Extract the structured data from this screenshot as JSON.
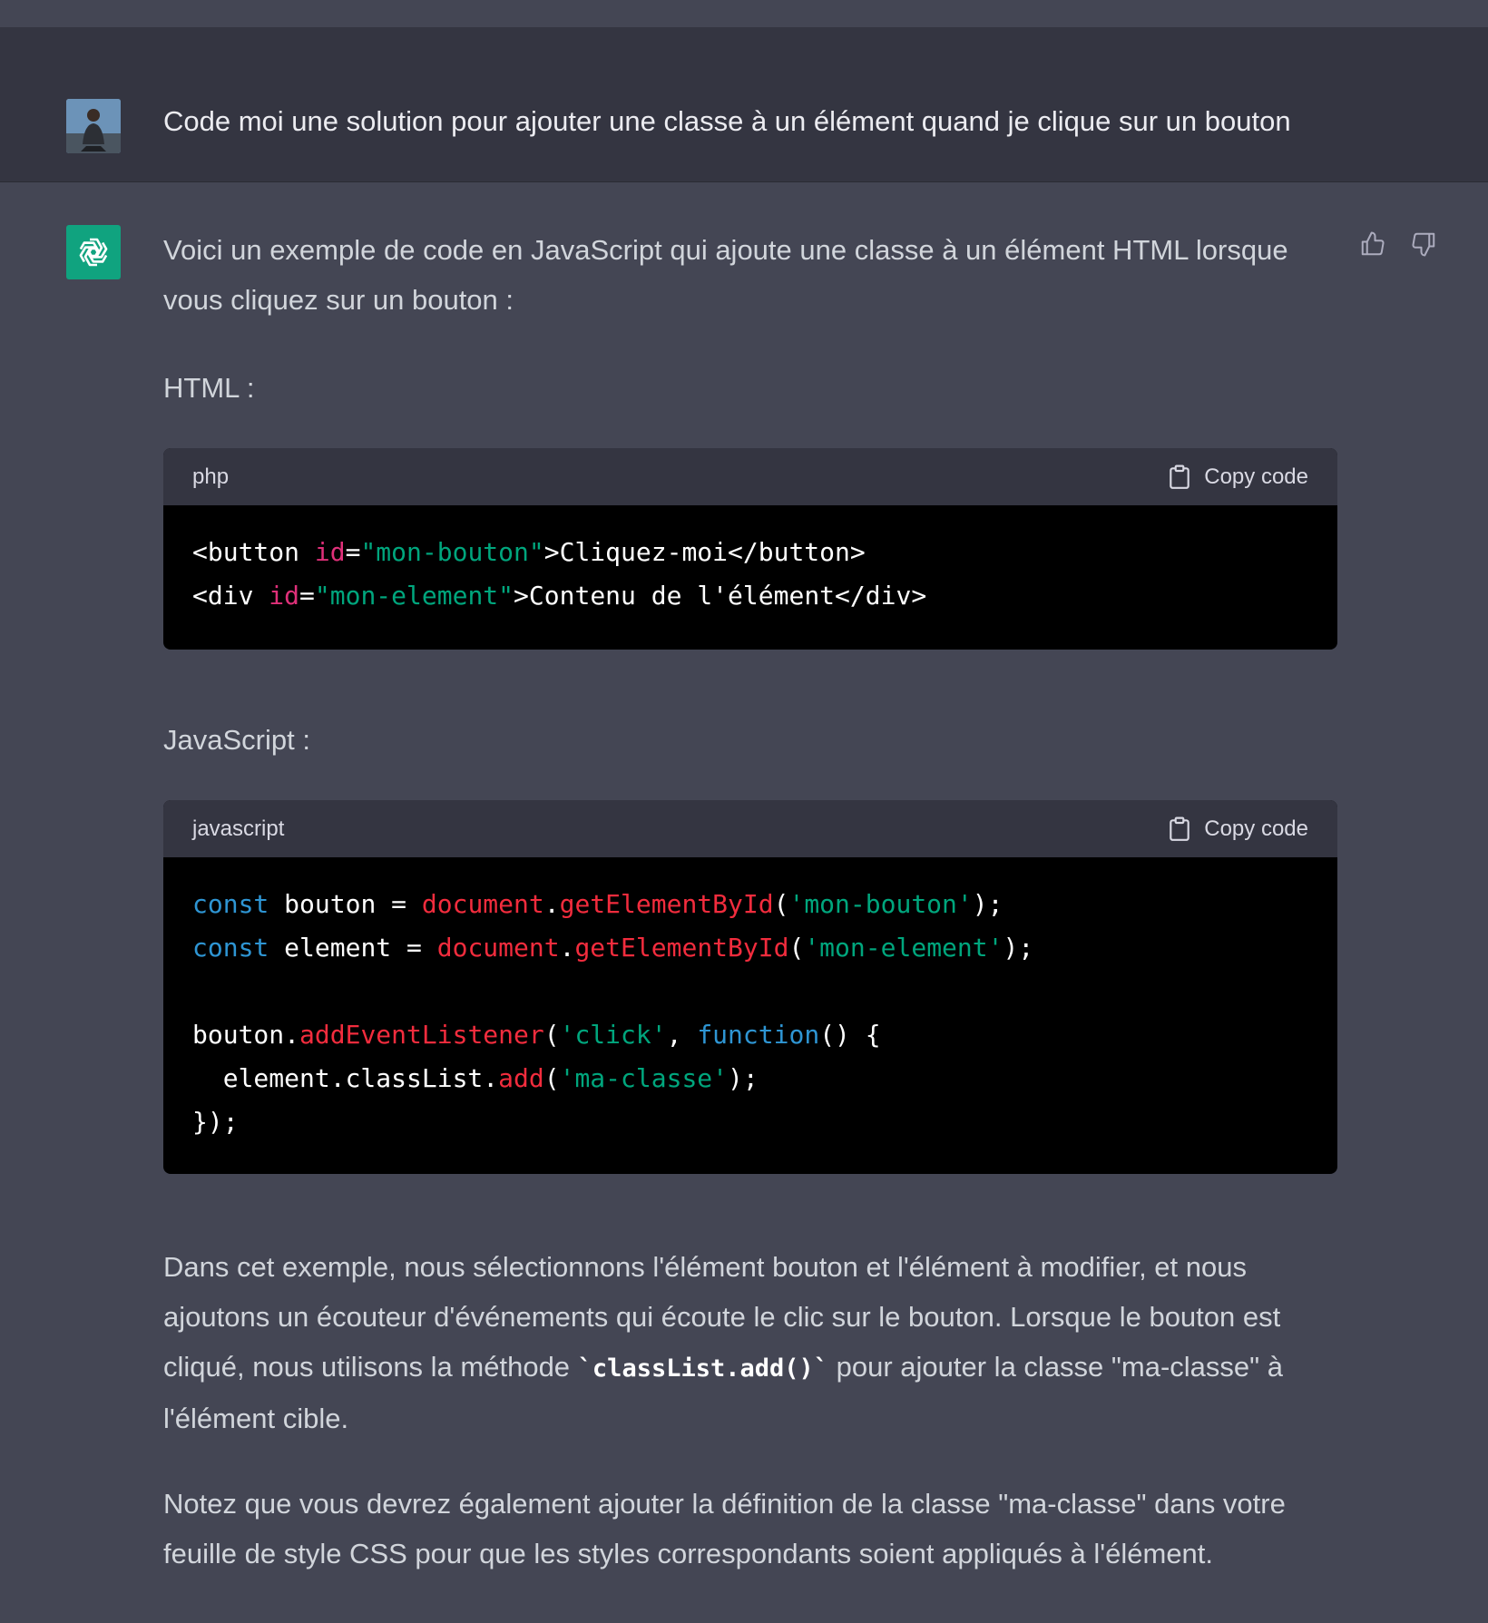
{
  "user_message": {
    "text": "Code moi une solution pour ajouter une classe à un élément quand je clique sur un bouton"
  },
  "assistant_message": {
    "intro": "Voici un exemple de code en JavaScript qui ajoute une classe à un élément HTML lorsque vous cliquez sur un bouton :",
    "html_label": "HTML :",
    "js_label": "JavaScript :",
    "explain_before": "Dans cet exemple, nous sélectionnons l'élément bouton et l'élément à modifier, et nous ajoutons un écouteur d'événements qui écoute le clic sur le bouton. Lorsque le bouton est cliqué, nous utilisons la méthode ",
    "explain_code": "`classList.add()`",
    "explain_after": " pour ajouter la classe \"ma-classe\" à l'élément cible.",
    "note": "Notez que vous devrez également ajouter la définition de la classe \"ma-classe\" dans votre feuille de style CSS pour que les styles correspondants soient appliqués à l'élément."
  },
  "code_blocks": [
    {
      "language": "php",
      "copy_label": "Copy code",
      "lines": [
        [
          [
            "t",
            "<button "
          ],
          [
            "attr",
            "id"
          ],
          [
            "t",
            "="
          ],
          [
            "str",
            "\"mon-bouton\""
          ],
          [
            "t",
            ">Cliquez-moi</button>"
          ]
        ],
        [
          [
            "t",
            "<div "
          ],
          [
            "attr",
            "id"
          ],
          [
            "t",
            "="
          ],
          [
            "str",
            "\"mon-element\""
          ],
          [
            "t",
            ">Contenu de l'élément</div>"
          ]
        ]
      ]
    },
    {
      "language": "javascript",
      "copy_label": "Copy code",
      "lines": [
        [
          [
            "kw",
            "const"
          ],
          [
            "t",
            " bouton = "
          ],
          [
            "obj",
            "document"
          ],
          [
            "t",
            "."
          ],
          [
            "fn",
            "getElementById"
          ],
          [
            "t",
            "("
          ],
          [
            "str",
            "'mon-bouton'"
          ],
          [
            "t",
            ");"
          ]
        ],
        [
          [
            "kw",
            "const"
          ],
          [
            "t",
            " element = "
          ],
          [
            "obj",
            "document"
          ],
          [
            "t",
            "."
          ],
          [
            "fn",
            "getElementById"
          ],
          [
            "t",
            "("
          ],
          [
            "str",
            "'mon-element'"
          ],
          [
            "t",
            ");"
          ]
        ],
        [],
        [
          [
            "t",
            "bouton."
          ],
          [
            "fn",
            "addEventListener"
          ],
          [
            "t",
            "("
          ],
          [
            "str",
            "'click'"
          ],
          [
            "t",
            ", "
          ],
          [
            "kw",
            "function"
          ],
          [
            "t",
            "() {"
          ]
        ],
        [
          [
            "t",
            "  element.classList."
          ],
          [
            "fn",
            "add"
          ],
          [
            "t",
            "("
          ],
          [
            "str",
            "'ma-classe'"
          ],
          [
            "t",
            ");"
          ]
        ],
        [
          [
            "t",
            "});"
          ]
        ]
      ]
    }
  ],
  "colors": {
    "user_bg": "#343541",
    "assistant_bg": "#444654",
    "gpt_avatar": "#10a37f",
    "code_bg": "#000000",
    "code_header_bg": "#343541",
    "keyword": "#2e95d3",
    "function": "#f22c3d",
    "string": "#00a67d",
    "attribute": "#df3079"
  },
  "icons": {
    "user_avatar": "user-photo",
    "assistant_avatar": "openai-logo-icon",
    "thumbs_up": "thumbs-up-icon",
    "thumbs_down": "thumbs-down-icon",
    "copy": "clipboard-icon"
  }
}
